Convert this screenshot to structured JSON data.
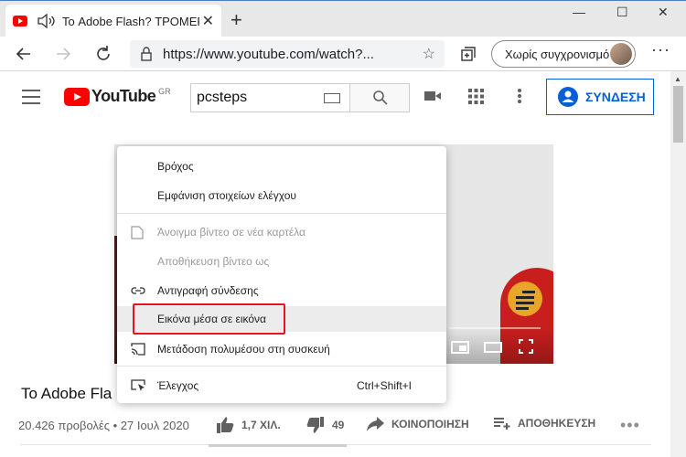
{
  "browser": {
    "tab_title": "Το Adobe Flash? ΤΡΟΜΕΡΗ",
    "tab_close": "✕",
    "new_tab": "+",
    "window_controls": {
      "minimize": "—",
      "maximize": "☐",
      "close": "✕"
    },
    "url": "https://www.youtube.com/watch?...",
    "star": "☆",
    "profile_label": "Χωρίς συγχρονισμό",
    "more": "···"
  },
  "youtube": {
    "logo_text": "YouTube",
    "country_code": "GR",
    "search_query": "pcsteps",
    "signin_label": "ΣΥΝΔΕΣΗ"
  },
  "video": {
    "title": "To Adobe Fla",
    "meta": "20.426 προβολές • 27 Ιουλ 2020",
    "likes": "1,7 ΧΙΛ.",
    "dislikes": "49",
    "share_label": "ΚΟΙΝΟΠΟΙΗΣΗ",
    "save_label": "ΑΠΟΘΗΚΕΥΣΗ",
    "more": "•••"
  },
  "context_menu": {
    "items": [
      {
        "label": "Βρόχος",
        "disabled": false
      },
      {
        "label": "Εμφάνιση στοιχείων ελέγχου",
        "disabled": false
      },
      {
        "label": "Άνοιγμα βίντεο σε νέα καρτέλα",
        "disabled": true
      },
      {
        "label": "Αποθήκευση βίντεο ως",
        "disabled": true
      },
      {
        "label": "Αντιγραφή σύνδεσης",
        "disabled": false
      },
      {
        "label": "Εικόνα μέσα σε εικόνα",
        "disabled": false
      },
      {
        "label": "Μετάδοση πολυμέσου στη συσκευή",
        "disabled": false
      },
      {
        "label": "Έλεγχος",
        "shortcut": "Ctrl+Shift+I",
        "disabled": false
      }
    ]
  },
  "colors": {
    "youtube_red": "#ff0000",
    "signin_blue": "#065fd4",
    "highlight_red": "#e8141b"
  }
}
